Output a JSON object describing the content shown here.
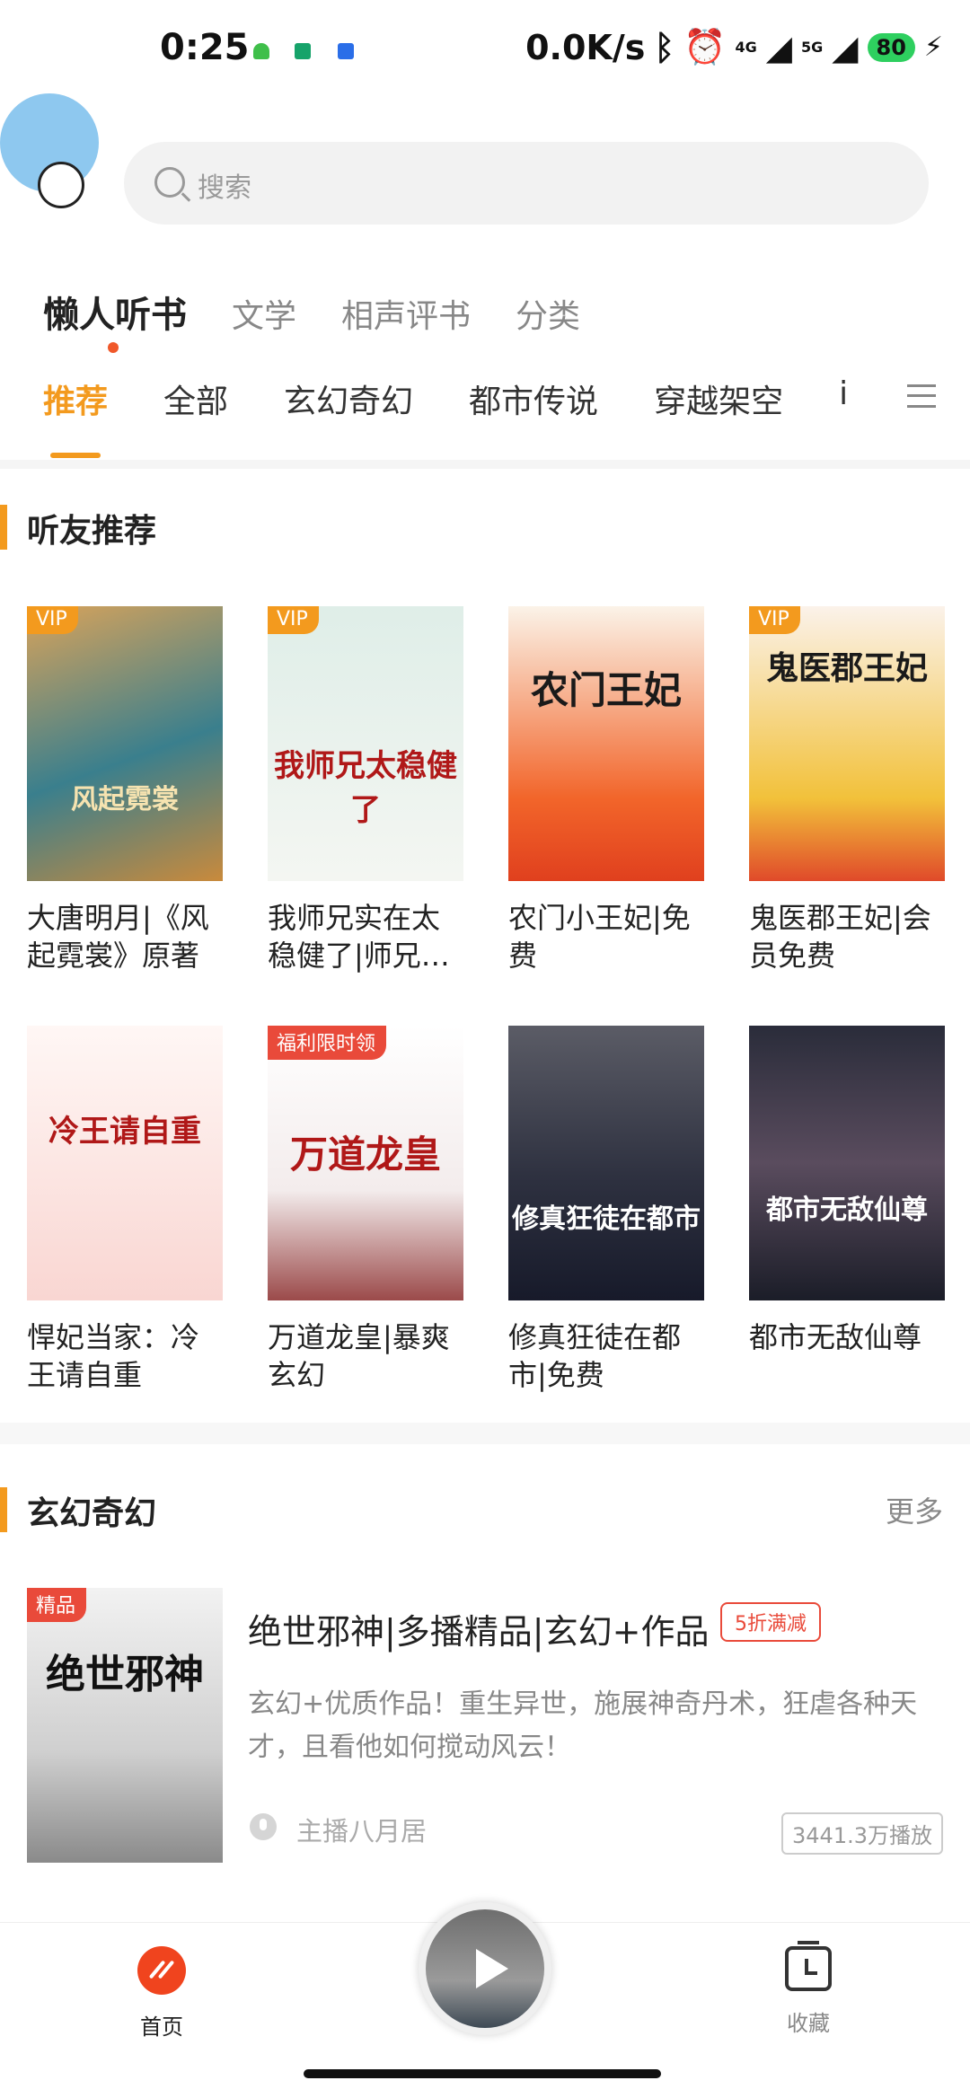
{
  "status_bar": {
    "time": "0:25",
    "speed": "0.0K/s",
    "net_4g": "4G",
    "net_5g": "5G",
    "battery": "80"
  },
  "search": {
    "placeholder": "搜索"
  },
  "top_tabs": [
    "懒人听书",
    "文学",
    "相声评书",
    "分类"
  ],
  "sub_tabs": [
    "推荐",
    "全部",
    "玄幻奇幻",
    "都市传说",
    "穿越架空",
    "i"
  ],
  "section1": {
    "title": "听友推荐",
    "books": [
      {
        "title": "大唐明月|《风起霓裳》原著",
        "cover_text": "风起霓裳",
        "badge": "VIP"
      },
      {
        "title": "我师兄实在太稳健了|师兄…",
        "cover_text": "我师兄太稳健了",
        "badge": "VIP"
      },
      {
        "title": "农门小王妃|免费",
        "cover_text": "农门王妃",
        "badge": ""
      },
      {
        "title": "鬼医郡王妃|会员免费",
        "cover_text": "鬼医郡王妃",
        "badge": "VIP"
      },
      {
        "title": "悍妃当家：冷王请自重",
        "cover_text": "冷王请自重",
        "badge": ""
      },
      {
        "title": "万道龙皇|暴爽玄幻",
        "cover_text": "万道龙皇",
        "badge": "福利限时领"
      },
      {
        "title": "修真狂徒在都市|免费",
        "cover_text": "修真狂徒在都市",
        "badge": ""
      },
      {
        "title": "都市无敌仙尊",
        "cover_text": "都市无敌仙尊",
        "badge": ""
      }
    ]
  },
  "section2": {
    "title": "玄幻奇幻",
    "more": "更多",
    "featured": {
      "badge": "精品",
      "cover_text": "绝世邪神",
      "title": "绝世邪神|多播精品|玄幻+作品",
      "discount": "5折满减",
      "description": "玄幻+优质作品！重生异世，施展神奇丹术，狂虐各种天才，且看他如何搅动风云！",
      "host": "主播八月居",
      "plays": "3441.3万播放"
    }
  },
  "bottom_nav": {
    "home": "首页",
    "favorites": "收藏"
  },
  "colors": {
    "accent": "#f39a1e",
    "red": "#e94a3a",
    "home_icon": "#f0441e"
  }
}
